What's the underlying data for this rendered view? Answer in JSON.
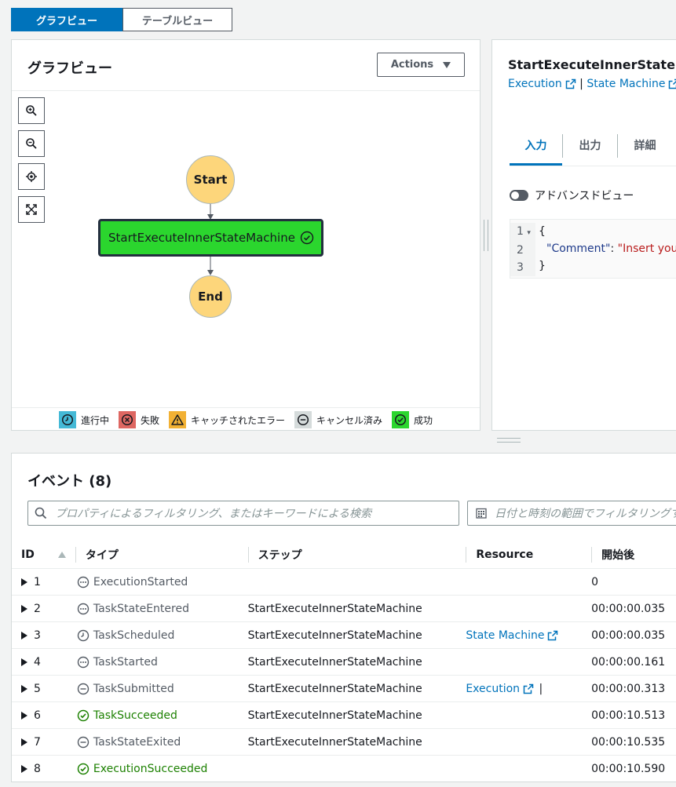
{
  "view_switch": {
    "graph": "グラフビュー",
    "table": "テーブルビュー"
  },
  "graph": {
    "title": "グラフビュー",
    "actions_label": "Actions",
    "nodes": {
      "start": "Start",
      "task": "StartExecuteInnerStateMachine",
      "end": "End"
    },
    "legend": [
      {
        "label": "進行中",
        "color": "#44b9d6"
      },
      {
        "label": "失敗",
        "color": "#de6762"
      },
      {
        "label": "キャッチされたエラー",
        "color": "#f2b134"
      },
      {
        "label": "キャンセル済み",
        "color": "#d5dbdb"
      },
      {
        "label": "成功",
        "color": "#2bd62e"
      }
    ]
  },
  "detail": {
    "title": "StartExecuteInnerStateMa",
    "link_execution": "Execution",
    "link_separator": "|",
    "link_state_machine": "State Machine",
    "tabs": [
      "入力",
      "出力",
      "詳細"
    ],
    "advanced_view": "アドバンスドビュー",
    "code": {
      "line_numbers": [
        "1",
        "2",
        "3"
      ],
      "line1": "{",
      "key": "\"Comment\"",
      "colon": ": ",
      "value": "\"Insert your",
      "line3": "}"
    }
  },
  "events": {
    "title": "イベント (8)",
    "search_placeholder": "プロパティによるフィルタリング、またはキーワードによる検索",
    "date_placeholder": "日付と時刻の範囲でフィルタリングす",
    "columns": {
      "id": "ID",
      "type": "タイプ",
      "step": "ステップ",
      "resource": "Resource",
      "elapsed": "開始後"
    },
    "rows": [
      {
        "id": "1",
        "type": "ExecutionStarted",
        "step": "",
        "resource": "",
        "elapsed": "0"
      },
      {
        "id": "2",
        "type": "TaskStateEntered",
        "step": "StartExecuteInnerStateMachine",
        "resource": "",
        "elapsed": "00:00:00.035"
      },
      {
        "id": "3",
        "type": "TaskScheduled",
        "step": "StartExecuteInnerStateMachine",
        "resource": "State Machine",
        "elapsed": "00:00:00.035"
      },
      {
        "id": "4",
        "type": "TaskStarted",
        "step": "StartExecuteInnerStateMachine",
        "resource": "",
        "elapsed": "00:00:00.161"
      },
      {
        "id": "5",
        "type": "TaskSubmitted",
        "step": "StartExecuteInnerStateMachine",
        "resource": "Execution",
        "elapsed": "00:00:00.313"
      },
      {
        "id": "6",
        "type": "TaskSucceeded",
        "step": "StartExecuteInnerStateMachine",
        "resource": "",
        "elapsed": "00:00:10.513"
      },
      {
        "id": "7",
        "type": "TaskStateExited",
        "step": "StartExecuteInnerStateMachine",
        "resource": "",
        "elapsed": "00:00:10.535"
      },
      {
        "id": "8",
        "type": "ExecutionSucceeded",
        "step": "",
        "resource": "",
        "elapsed": "00:00:10.590"
      }
    ],
    "resource_extra_5": "|"
  },
  "colors": {
    "accent": "#0073bb",
    "node_start_end": "#fdd67b",
    "node_success": "#2bd62e",
    "success_text": "#1d8102"
  }
}
